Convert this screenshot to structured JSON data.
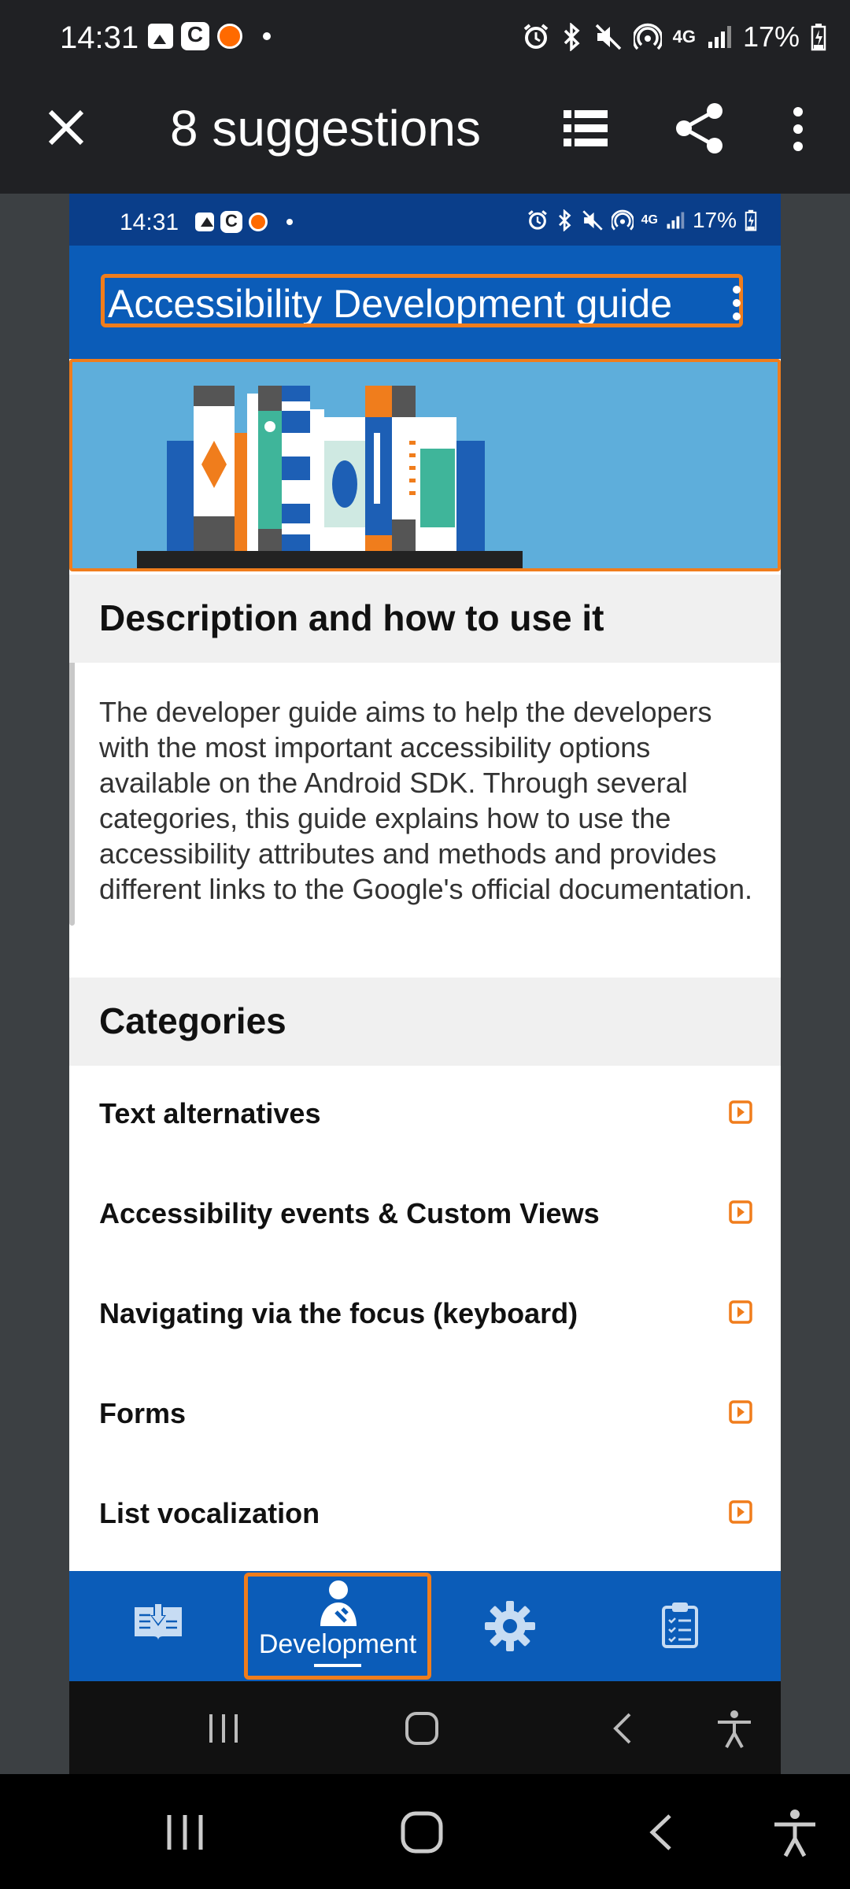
{
  "outer_status": {
    "time": "14:31",
    "battery": "17%",
    "network": "4G"
  },
  "outer_appbar": {
    "title": "8 suggestions",
    "close_icon": "close-icon",
    "list_icon": "list-icon",
    "share_icon": "share-icon",
    "more_icon": "more-vert-icon"
  },
  "inner_status": {
    "time": "14:31",
    "battery": "17%",
    "network": "4G"
  },
  "inner_appbar": {
    "title": "Accessibility Development guide",
    "more_icon": "more-vert-icon"
  },
  "description": {
    "header": "Description and how to use it",
    "text": "The developer guide aims to help the developers with the most important accessibility options available on the Android SDK. Through several categories, this guide explains how to use the accessibility attributes and methods and provides different links to the Google's official documentation."
  },
  "categories": {
    "header": "Categories",
    "items": [
      {
        "label": "Text alternatives"
      },
      {
        "label": "Accessibility events & Custom Views"
      },
      {
        "label": "Navigating via the focus (keyboard)"
      },
      {
        "label": "Forms"
      },
      {
        "label": "List vocalization"
      }
    ]
  },
  "bottom_nav": {
    "items": [
      {
        "icon": "book-download-icon",
        "label": ""
      },
      {
        "icon": "developer-icon",
        "label": "Development",
        "selected": true
      },
      {
        "icon": "gear-icon",
        "label": ""
      },
      {
        "icon": "clipboard-icon",
        "label": ""
      }
    ]
  },
  "colors": {
    "accent_orange": "#f07d1c",
    "app_blue": "#0b5cb8",
    "status_dark_blue": "#0a3e8a",
    "banner_blue": "#5eaedb"
  }
}
